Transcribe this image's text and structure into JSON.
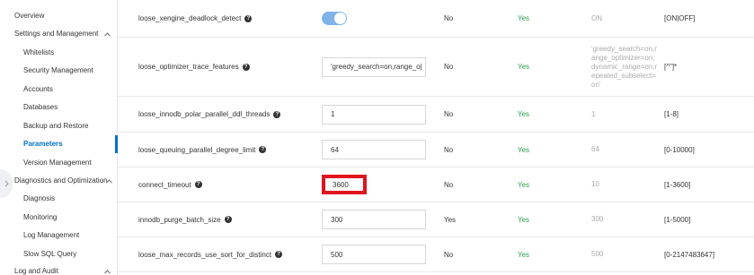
{
  "theme": {
    "accent": "#ff6a00",
    "active": "#0070cc",
    "modifiable": "#2e9e4a",
    "highlight": "#e0141e",
    "toggle_on": "#7fb3ea"
  },
  "sidebar": {
    "items": [
      {
        "label": "Overview"
      },
      {
        "label": "Settings and Management"
      },
      {
        "label": "Whitelists"
      },
      {
        "label": "Security Management"
      },
      {
        "label": "Accounts"
      },
      {
        "label": "Databases"
      },
      {
        "label": "Backup and Restore"
      },
      {
        "label": "Parameters"
      },
      {
        "label": "Version Management"
      },
      {
        "label": "Diagnostics and Optimization"
      },
      {
        "label": "Diagnosis"
      },
      {
        "label": "Monitoring"
      },
      {
        "label": "Log Management"
      },
      {
        "label": "Slow SQL Query"
      },
      {
        "label": "Log and Audit"
      }
    ]
  },
  "params": {
    "rows": [
      {
        "name": "loose_xengine_deadlock_detect",
        "value": "",
        "control": "toggle-on",
        "restart": "No",
        "modifiable": "Yes",
        "default": "ON",
        "range": "[ON|OFF]"
      },
      {
        "name": "loose_optimizer_trace_features",
        "value": "'greedy_search=on,range_o|",
        "control": "text",
        "restart": "No",
        "modifiable": "Yes",
        "default": "'greedy_search=on,range_optimizer=on,dynamic_range=on,repeated_subselect=on'",
        "range": "[^\"]*"
      },
      {
        "name": "loose_innodb_polar_parallel_ddl_threads",
        "value": "1",
        "control": "text",
        "restart": "No",
        "modifiable": "Yes",
        "default": "1",
        "range": "[1-8]"
      },
      {
        "name": "loose_queuing_parallel_degree_limit",
        "value": "64",
        "control": "text",
        "restart": "No",
        "modifiable": "Yes",
        "default": "64",
        "range": "[0-10000]"
      },
      {
        "name": "connect_timeout",
        "value": "3600",
        "control": "text",
        "restart": "No",
        "modifiable": "Yes",
        "default": "10",
        "range": "[1-3600]"
      },
      {
        "name": "innodb_purge_batch_size",
        "value": "300",
        "control": "text",
        "restart": "Yes",
        "modifiable": "Yes",
        "default": "300",
        "range": "[1-5000]"
      },
      {
        "name": "loose_max_records_use_sort_for_distinct",
        "value": "500",
        "control": "text",
        "restart": "No",
        "modifiable": "Yes",
        "default": "500",
        "range": "[0-2147483647]"
      }
    ]
  }
}
